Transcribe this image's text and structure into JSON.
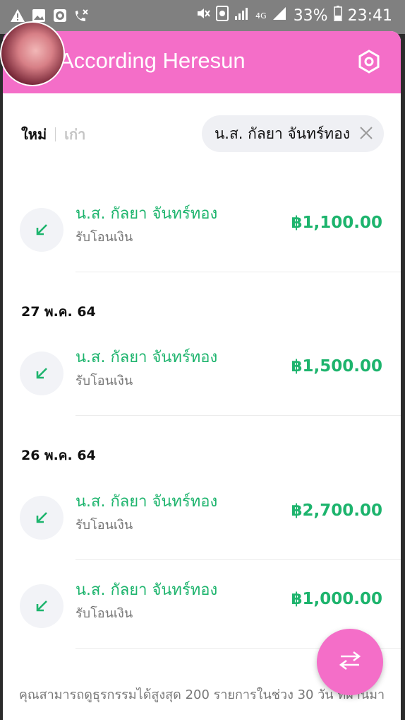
{
  "status_bar": {
    "signal_label": "4G",
    "battery": "33%",
    "time": "23:41"
  },
  "header": {
    "title": "According Heresun"
  },
  "tabs": {
    "new": "ใหม่",
    "old": "เก่า"
  },
  "filter_chip": {
    "label": "น.ส. กัลยา จันทร์ทอง"
  },
  "transactions": [
    {
      "name": "น.ส. กัลยา จันทร์ทอง",
      "type": "รับโอนเงิน",
      "amount": "฿1,100.00"
    },
    {
      "date": "27 พ.ค. 64",
      "name": "น.ส. กัลยา จันทร์ทอง",
      "type": "รับโอนเงิน",
      "amount": "฿1,500.00"
    },
    {
      "date": "26 พ.ค. 64",
      "name": "น.ส. กัลยา จันทร์ทอง",
      "type": "รับโอนเงิน",
      "amount": "฿2,700.00"
    },
    {
      "name": "น.ส. กัลยา จันทร์ทอง",
      "type": "รับโอนเงิน",
      "amount": "฿1,000.00"
    }
  ],
  "footer_note": "คุณสามารถดูธุรกรรมได้สูงสุด 200 รายการในช่วง 30 วัน ที่ผ่านมา",
  "colors": {
    "accent": "#f46ec8",
    "amount_green": "#1db46d"
  }
}
